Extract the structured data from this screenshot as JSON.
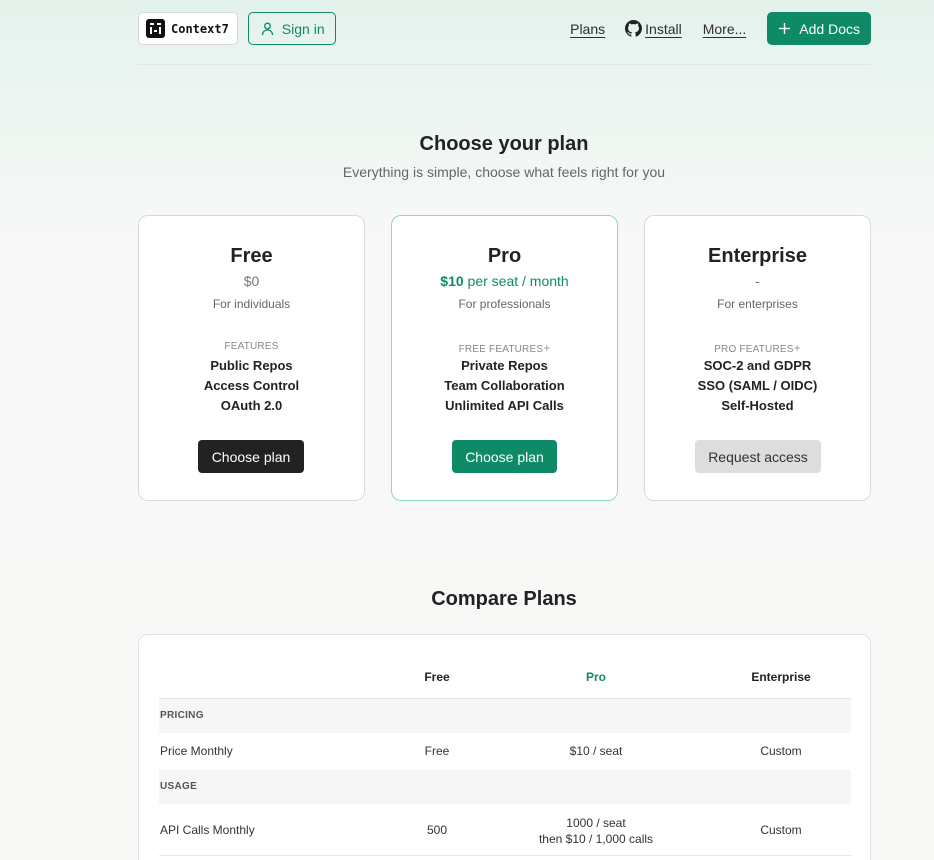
{
  "header": {
    "logo_text": "Context7",
    "signin_label": "Sign in",
    "nav": {
      "plans": "Plans",
      "install": "Install",
      "more": "More..."
    },
    "add_docs_label": "Add Docs"
  },
  "hero": {
    "title": "Choose your plan",
    "subtitle": "Everything is simple, choose what feels right for you"
  },
  "plans": [
    {
      "name": "Free",
      "price": "$0",
      "audience": "For individuals",
      "features_label": "FEATURES",
      "features": [
        "Public Repos",
        "Access Control",
        "OAuth 2.0"
      ],
      "button": "Choose plan"
    },
    {
      "name": "Pro",
      "price_amount": "$10",
      "price_unit": " per seat / month",
      "audience": "For professionals",
      "features_label": "FREE FEATURES",
      "features": [
        "Private Repos",
        "Team Collaboration",
        "Unlimited API Calls"
      ],
      "button": "Choose plan"
    },
    {
      "name": "Enterprise",
      "price": "-",
      "audience": "For enterprises",
      "features_label": "PRO FEATURES",
      "features": [
        "SOC-2 and GDPR",
        "SSO (SAML / OIDC)",
        "Self-Hosted"
      ],
      "button": "Request access"
    }
  ],
  "compare": {
    "title": "Compare Plans",
    "columns": [
      "Free",
      "Pro",
      "Enterprise"
    ],
    "sections": [
      {
        "name": "PRICING",
        "rows": [
          {
            "label": "Price Monthly",
            "values": [
              "Free",
              "$10 / seat",
              "Custom"
            ]
          }
        ]
      },
      {
        "name": "USAGE",
        "rows": [
          {
            "label": "API Calls Monthly",
            "values": [
              "500",
              "1000 / seat",
              "Custom"
            ],
            "pro_line2": "then $10 / 1,000 calls"
          }
        ]
      }
    ]
  },
  "colors": {
    "accent": "#0e8a66",
    "dark_button": "#222222",
    "gray_button": "#dddddd"
  },
  "icons": {
    "signin": "user-icon",
    "install": "github-icon",
    "add_docs": "plus-icon",
    "features_plus": "plus-icon"
  }
}
